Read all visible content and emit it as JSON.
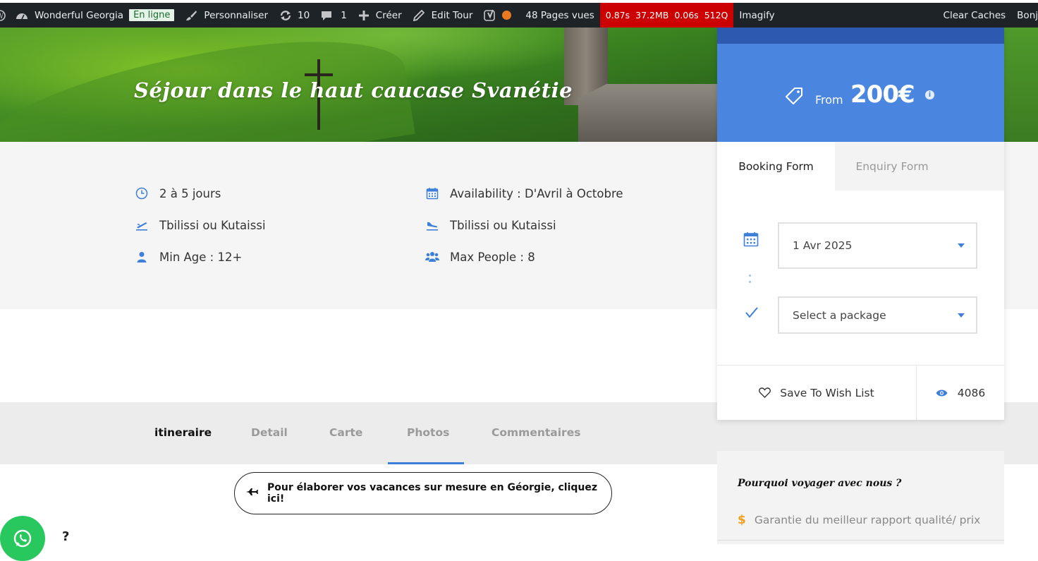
{
  "admin_bar": {
    "site_name": "Wonderful Georgia",
    "status_badge": "En ligne",
    "customize": "Personnaliser",
    "updates_count": "10",
    "comments_count": "1",
    "new_label": "Créer",
    "edit_label": "Edit Tour",
    "pageviews": "48 Pages vues",
    "perf": [
      "0.87s",
      "37.2MB",
      "0.06s",
      "512Q"
    ],
    "imagify": "Imagify",
    "clear_caches": "Clear Caches",
    "greeting": "Bonj"
  },
  "hero": {
    "title": "Séjour dans le haut caucase Svanétie"
  },
  "trip_info": {
    "duration": "2 à 5 jours",
    "availability": "Availability : D'Avril à Octobre",
    "departure": "Tbilissi ou Kutaissi",
    "arrival": "Tbilissi ou Kutaissi",
    "min_age": "Min Age : 12+",
    "max_people": "Max People : 8"
  },
  "booking": {
    "from_label": "From",
    "price": "200€",
    "info_icon": "i",
    "tabs": [
      "Booking Form",
      "Enquiry Form"
    ],
    "date_value": "1 Avr 2025",
    "package_placeholder": "Select a package",
    "wishlist_label": "Save To Wish List",
    "views_count": "4086"
  },
  "content_tabs": [
    "itineraire",
    "Detail",
    "Carte",
    "Photos",
    "Commentaires"
  ],
  "active_tab": "Photos",
  "cta": {
    "label": "Pour élaborer vos vacances sur mesure en Géorgie, cliquez ici!"
  },
  "why_us": {
    "title": "Pourquoi voyager avec nous ?",
    "items": [
      {
        "icon": "$",
        "label": "Garantie du meilleur rapport qualité/ prix"
      }
    ]
  },
  "misc": {
    "question_mark": "?"
  },
  "colors": {
    "accent": "#3d7fd9",
    "price_bg": "#4a86e0",
    "admin_bg": "#1d2327",
    "perf_bg": "#cc0000",
    "whatsapp": "#28c85f"
  }
}
